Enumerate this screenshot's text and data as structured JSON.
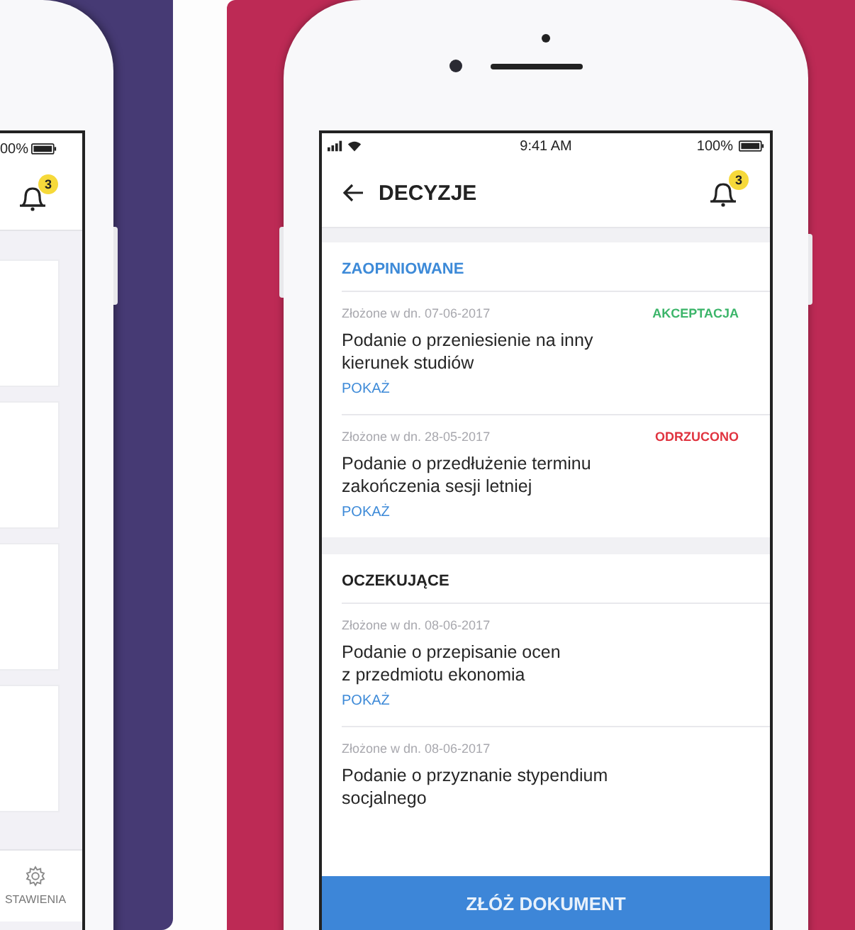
{
  "left_phone": {
    "battery": "00%",
    "badge": "3",
    "tab_label": "STAWIENIA"
  },
  "status_bar": {
    "time": "9:41 AM",
    "battery": "100%"
  },
  "header": {
    "title": "DECYZJE",
    "badge": "3"
  },
  "sections": [
    {
      "title": "ZAOPINIOWANE",
      "kind": "reviewed",
      "items": [
        {
          "date": "Złożone w dn. 07-06-2017",
          "status": "AKCEPTACJA",
          "color": "#3cb56a",
          "title": "Podanie o przeniesienie na inny\nkierunek studiów",
          "link": "POKAŻ"
        },
        {
          "date": "Złożone w dn. 28-05-2017",
          "status": "ODRZUCONO",
          "color": "#e0333f",
          "title": "Podanie o przedłużenie terminu\nzakończenia sesji letniej",
          "link": "POKAŻ"
        }
      ]
    },
    {
      "title": "OCZEKUJĄCE",
      "kind": "pending",
      "items": [
        {
          "date": "Złożone w dn. 08-06-2017",
          "title": "Podanie o przepisanie ocen\nz przedmiotu ekonomia",
          "link": "POKAŻ"
        },
        {
          "date": "Złożone w dn. 08-06-2017",
          "title": "Podanie o przyznanie stypendium\nsocjalnego"
        }
      ]
    }
  ],
  "primary_button": "ZŁÓŻ DOKUMENT"
}
